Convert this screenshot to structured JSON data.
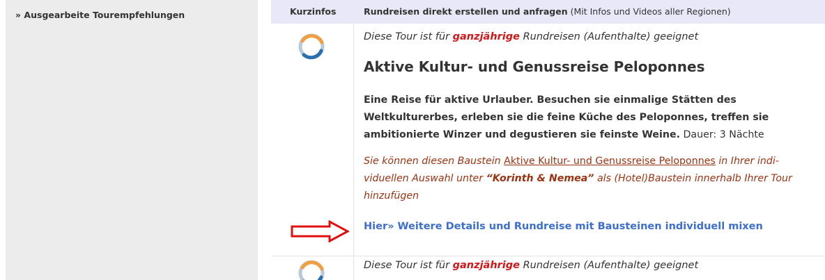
{
  "sidebar": {
    "link_label": "» Ausgearbeite Tourempfehlungen"
  },
  "header": {
    "col1": "Kurzinfos",
    "col2_strong": "Rundreisen direkt erstellen und anfragen",
    "col2_rest": " (Mit Infos und Videos aller Regionen)"
  },
  "tours": [
    {
      "suitability_prefix": "Diese Tour ist für ",
      "suitability_highlight": "ganzjährige",
      "suitability_suffix": " Rundreisen (Aufenthalte) geeignet",
      "title": "Aktive Kultur- und Genussreise Peloponnes",
      "description_bold": "Eine Reise für aktive Urlauber. Besuchen sie einmalige Stätten des Weltkulturerbes, erleben sie die feine Küche des Peloponnes, treffen sie ambitionierte Winzer und degustieren sie feinste Weine.",
      "description_rest": " Dauer: 3 Nächte",
      "baustein_prefix": "Sie können diesen Baustein ",
      "baustein_link": "Aktive Kultur- und Genussreise Peloponnes",
      "baustein_mid": " in Ihrer indi-viduellen Auswahl unter ",
      "baustein_strong": "“Korinth & Nemea”",
      "baustein_suffix": " als (Hotel)Baustein innerhalb Ihrer Tour hinzufügen",
      "detail_link": "Hier» Weitere Details und Rundreise mit Bausteinen individuell mixen"
    },
    {
      "suitability_prefix": "Diese Tour ist für ",
      "suitability_highlight": "ganzjährige",
      "suitability_suffix": " Rundreisen (Aufenthalte) geeignet"
    }
  ],
  "colors": {
    "header_bg": "#e8e8f9",
    "sidebar_bg": "#ececec",
    "highlight_red": "#d01818",
    "baustein_brown": "#9b3311",
    "link_blue": "#3c6fd1",
    "arrow_red": "#e01010"
  },
  "icons": {
    "tour_icon": "ring-logo-icon",
    "annotation": "red-outline-arrow-icon"
  }
}
